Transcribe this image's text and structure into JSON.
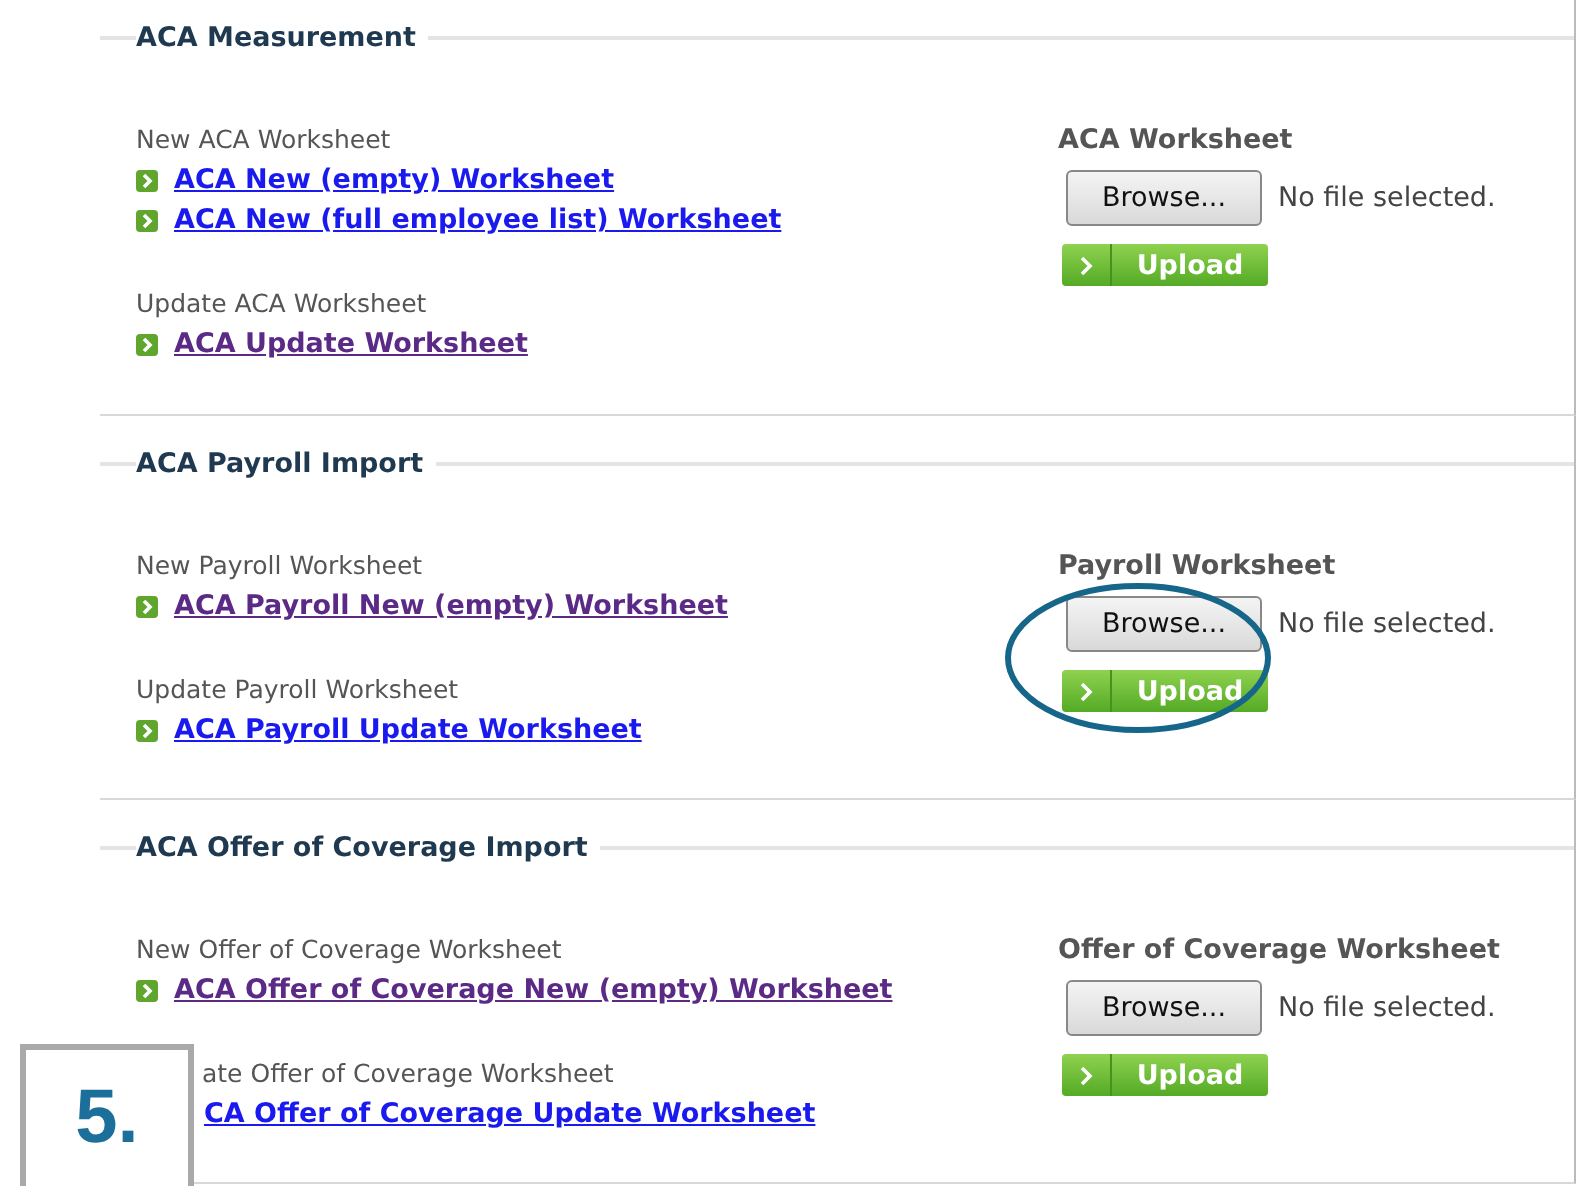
{
  "sections": [
    {
      "title": "ACA Measurement",
      "groups": [
        {
          "label": "New ACA Worksheet",
          "links": [
            {
              "text": "ACA New (empty) Worksheet",
              "visited": false
            },
            {
              "text": "ACA New (full employee list) Worksheet",
              "visited": false
            }
          ]
        },
        {
          "label": "Update ACA Worksheet",
          "links": [
            {
              "text": "ACA Update Worksheet",
              "visited": true
            }
          ]
        }
      ],
      "upload": {
        "title": "ACA Worksheet",
        "browse": "Browse...",
        "status": "No file selected.",
        "button": "Upload"
      }
    },
    {
      "title": "ACA Payroll Import",
      "groups": [
        {
          "label": "New Payroll Worksheet",
          "links": [
            {
              "text": "ACA Payroll New (empty) Worksheet",
              "visited": true
            }
          ]
        },
        {
          "label": "Update Payroll Worksheet",
          "links": [
            {
              "text": "ACA Payroll Update Worksheet",
              "visited": false
            }
          ]
        }
      ],
      "upload": {
        "title": "Payroll Worksheet",
        "browse": "Browse...",
        "status": "No file selected.",
        "button": "Upload",
        "highlighted": true
      }
    },
    {
      "title": "ACA Offer of Coverage Import",
      "groups": [
        {
          "label": "New Offer of Coverage Worksheet",
          "links": [
            {
              "text": "ACA Offer of Coverage New (empty) Worksheet",
              "visited": true
            }
          ]
        },
        {
          "label": "ate Offer of Coverage Worksheet",
          "kind": "covered",
          "links": [
            {
              "text": "CA Offer of Coverage Update Worksheet",
              "visited": false
            }
          ]
        }
      ],
      "upload": {
        "title": "Offer of Coverage Worksheet",
        "browse": "Browse...",
        "status": "No file selected.",
        "button": "Upload"
      }
    }
  ],
  "step_badge": "5."
}
